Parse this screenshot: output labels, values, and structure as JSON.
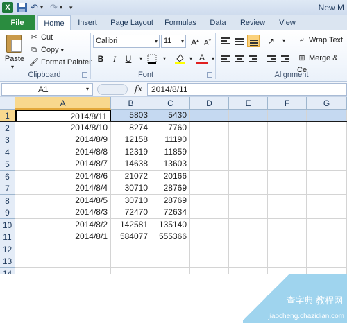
{
  "window": {
    "title": "New M"
  },
  "qat": {
    "xl": "X"
  },
  "tabs": {
    "file": "File",
    "items": [
      "Home",
      "Insert",
      "Page Layout",
      "Formulas",
      "Data",
      "Review",
      "View"
    ]
  },
  "clipboard": {
    "paste": "Paste",
    "cut": "Cut",
    "copy": "Copy",
    "format_painter": "Format Painter",
    "group": "Clipboard"
  },
  "font": {
    "name": "Calibri",
    "size": "11",
    "group": "Font",
    "bold": "B",
    "italic": "I",
    "underline": "U",
    "grow": "A",
    "shrink": "A",
    "font_color": "A"
  },
  "alignment": {
    "wrap_text": "Wrap Text",
    "merge": "Merge & Ce",
    "group": "Alignment"
  },
  "formula_bar": {
    "name_box": "A1",
    "fx": "fx",
    "value": "2014/8/11"
  },
  "grid": {
    "columns": [
      "A",
      "B",
      "C",
      "D",
      "E",
      "F",
      "G"
    ],
    "rows": [
      {
        "n": "1",
        "a": "2014/8/11",
        "b": "5803",
        "c": "5430"
      },
      {
        "n": "2",
        "a": "2014/8/10",
        "b": "8274",
        "c": "7760"
      },
      {
        "n": "3",
        "a": "2014/8/9",
        "b": "12158",
        "c": "11190"
      },
      {
        "n": "4",
        "a": "2014/8/8",
        "b": "12319",
        "c": "11859"
      },
      {
        "n": "5",
        "a": "2014/8/7",
        "b": "14638",
        "c": "13603"
      },
      {
        "n": "6",
        "a": "2014/8/6",
        "b": "21072",
        "c": "20166"
      },
      {
        "n": "7",
        "a": "2014/8/4",
        "b": "30710",
        "c": "28769"
      },
      {
        "n": "8",
        "a": "2014/8/5",
        "b": "30710",
        "c": "28769"
      },
      {
        "n": "9",
        "a": "2014/8/3",
        "b": "72470",
        "c": "72634"
      },
      {
        "n": "10",
        "a": "2014/8/2",
        "b": "142581",
        "c": "135140"
      },
      {
        "n": "11",
        "a": "2014/8/1",
        "b": "584077",
        "c": "555366"
      },
      {
        "n": "12",
        "a": "",
        "b": "",
        "c": ""
      },
      {
        "n": "13",
        "a": "",
        "b": "",
        "c": ""
      },
      {
        "n": "14",
        "a": "",
        "b": "",
        "c": ""
      }
    ]
  },
  "watermark": {
    "line1": "查字典 教程网",
    "line2": "jiaocheng.chazidian.com"
  },
  "colors": {
    "file_tab": "#2a8c3f",
    "selection": "#c5d9f1",
    "header_selected": "#f8d88e"
  }
}
